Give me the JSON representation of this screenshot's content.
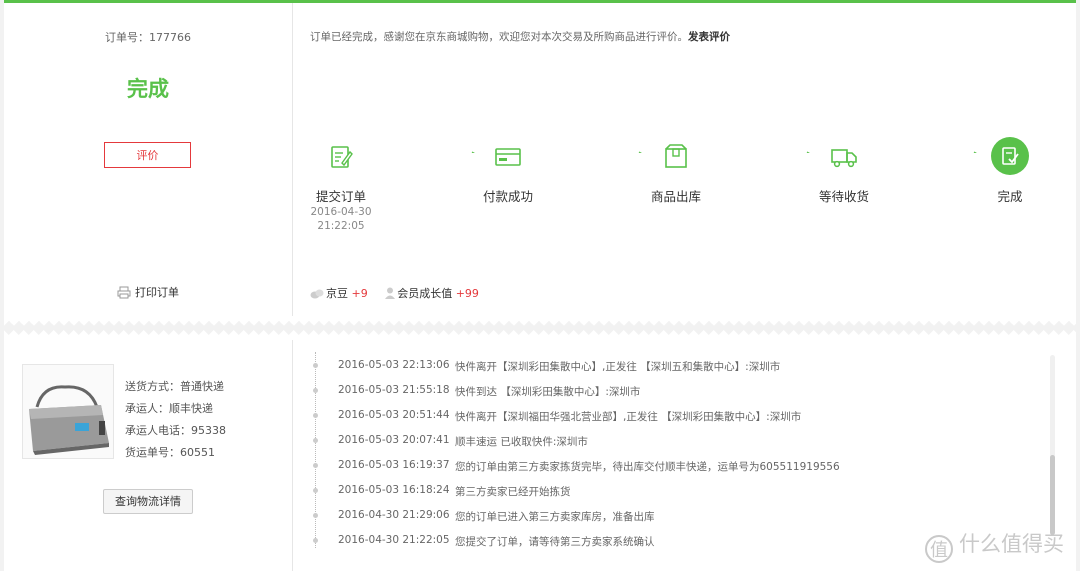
{
  "order": {
    "number_label": "订单号：177766",
    "status": "完成",
    "review_button": "评价",
    "print_label": "打印订单",
    "notice": "订单已经完成，感谢您在京东商城购物，欢迎您对本次交易及所购商品进行评价。",
    "notice_link": "发表评价"
  },
  "steps": [
    {
      "label": "提交订单",
      "time1": "2016-04-30",
      "time2": "21:22:05",
      "icon": "edit-icon"
    },
    {
      "label": "付款成功",
      "time1": "",
      "time2": "",
      "icon": "card-icon"
    },
    {
      "label": "商品出库",
      "time1": "",
      "time2": "",
      "icon": "package-icon"
    },
    {
      "label": "等待收货",
      "time1": "",
      "time2": "",
      "icon": "truck-icon"
    },
    {
      "label": "完成",
      "time1": "",
      "time2": "",
      "icon": "check-doc-icon"
    }
  ],
  "rewards": {
    "beans_label": "京豆",
    "beans_value": "+9",
    "growth_label": "会员成长值",
    "growth_value": "+99"
  },
  "shipping": {
    "method": "送货方式：普通快递",
    "carrier": "承运人：顺丰快递",
    "phone": "承运人电话：95338",
    "tracking": "货运单号：60551",
    "track_button": "查询物流详情"
  },
  "timeline": [
    {
      "time": "2016-05-03 22:13:06",
      "text": "快件离开【深圳彩田集散中心】,正发往 【深圳五和集散中心】:深圳市"
    },
    {
      "time": "2016-05-03 21:55:18",
      "text": "快件到达 【深圳彩田集散中心】:深圳市"
    },
    {
      "time": "2016-05-03 20:51:44",
      "text": "快件离开【深圳福田华强北营业部】,正发往 【深圳彩田集散中心】:深圳市"
    },
    {
      "time": "2016-05-03 20:07:41",
      "text": "顺丰速运 已收取快件:深圳市"
    },
    {
      "time": "2016-05-03 16:19:37",
      "text": "您的订单由第三方卖家拣货完毕，待出库交付顺丰快递，运单号为605511919556"
    },
    {
      "time": "2016-05-03 16:18:24",
      "text": "第三方卖家已经开始拣货"
    },
    {
      "time": "2016-04-30 21:29:06",
      "text": "您的订单已进入第三方卖家库房，准备出库"
    },
    {
      "time": "2016-04-30 21:22:05",
      "text": "您提交了订单，请等待第三方卖家系统确认"
    }
  ],
  "watermark": "什么值得买",
  "colors": {
    "accent": "#59c14a",
    "red": "#e4393c"
  }
}
